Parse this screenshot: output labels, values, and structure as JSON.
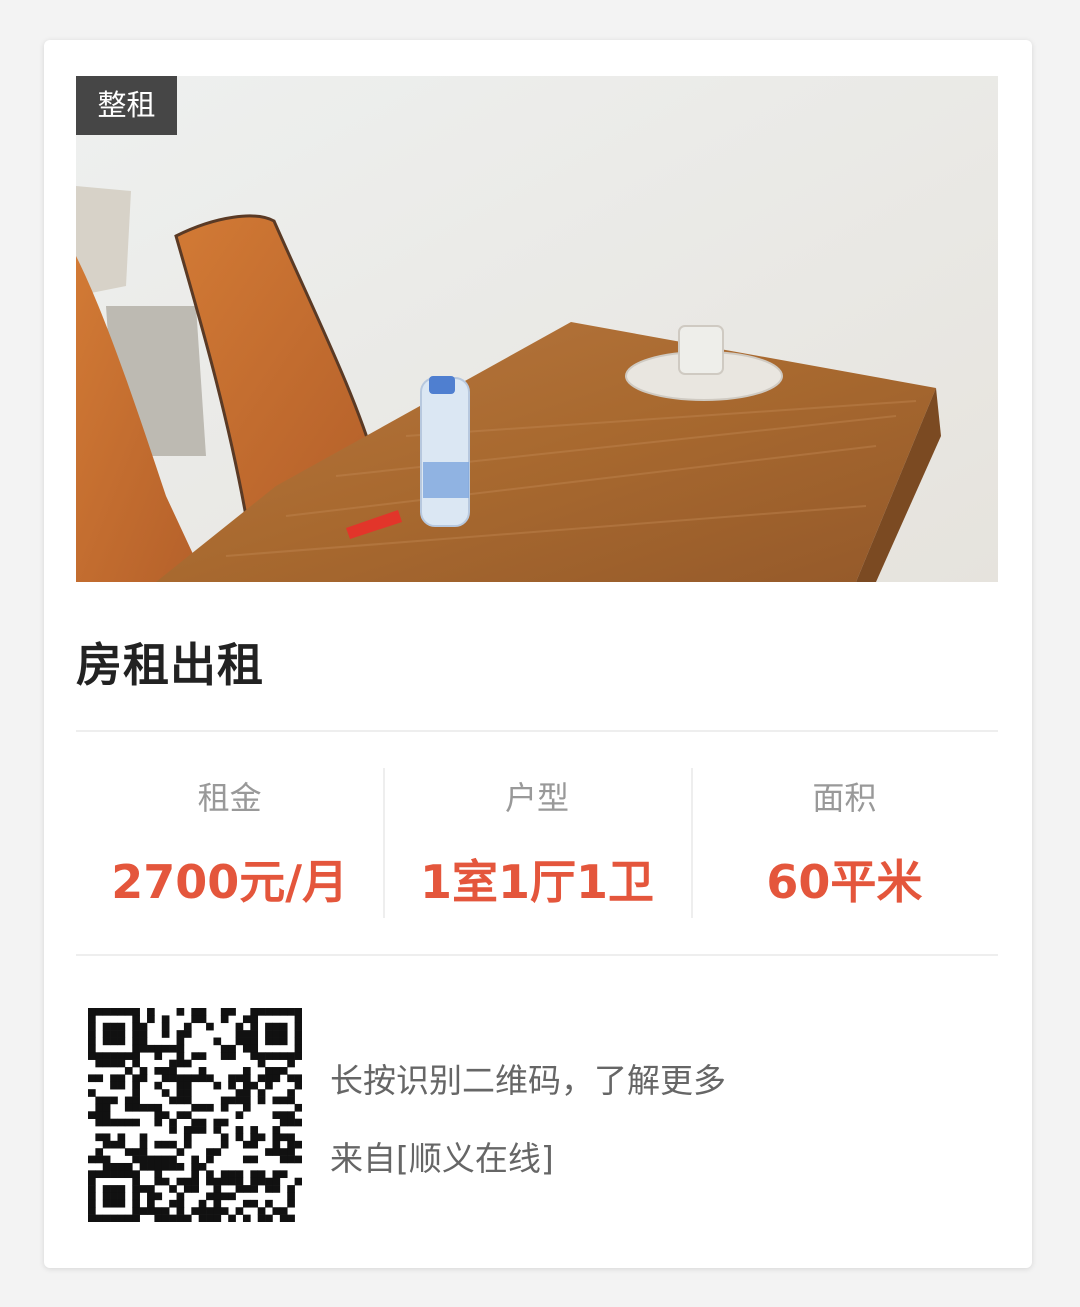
{
  "listing": {
    "tag": "整租",
    "title": "房租出租",
    "photo_alt": "dining-table-photo"
  },
  "stats": [
    {
      "label": "租金",
      "value": "2700元/月"
    },
    {
      "label": "户型",
      "value": "1室1厅1卫"
    },
    {
      "label": "面积",
      "value": "60平米"
    }
  ],
  "footer": {
    "qr_hint": "长按识别二维码，了解更多",
    "source": "来自[顺义在线]"
  },
  "colors": {
    "accent": "#e4563c",
    "label": "#999999",
    "title": "#222222",
    "tag_bg": "#282828"
  }
}
